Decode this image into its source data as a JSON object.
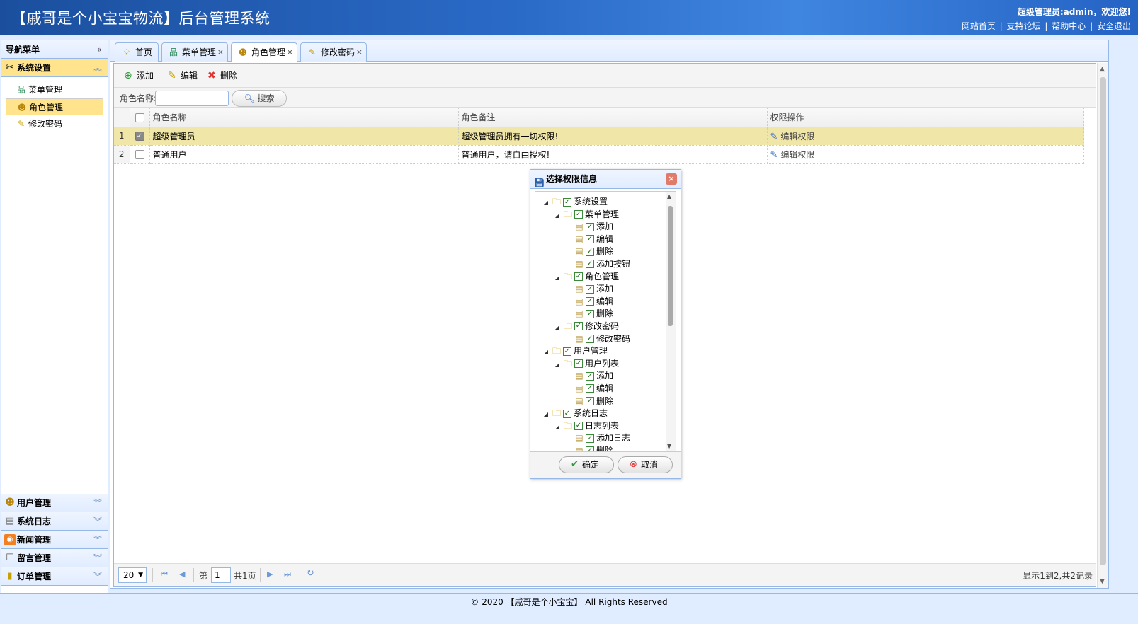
{
  "header": {
    "title": "【戚哥是个小宝宝物流】后台管理系统",
    "welcome": "超级管理员:admin，欢迎您!",
    "links": [
      "网站首页",
      "支持论坛",
      "帮助中心",
      "安全退出"
    ],
    "link_separator": "|"
  },
  "nav": {
    "title": "导航菜单",
    "collapse_icon": "«",
    "sections": [
      {
        "label": "系统设置",
        "icon": "tools-icon",
        "expanded": true
      },
      {
        "label": "用户管理",
        "icon": "users-icon"
      },
      {
        "label": "系统日志",
        "icon": "log-icon"
      },
      {
        "label": "新闻管理",
        "icon": "rss-icon"
      },
      {
        "label": "留言管理",
        "icon": "comment-icon"
      },
      {
        "label": "订单管理",
        "icon": "order-icon"
      }
    ],
    "items": [
      {
        "label": "菜单管理",
        "icon": "sitemap-icon"
      },
      {
        "label": "角色管理",
        "icon": "role-icon",
        "selected": true
      },
      {
        "label": "修改密码",
        "icon": "key-icon"
      }
    ]
  },
  "tabs": [
    {
      "label": "首页",
      "icon": "lightbulb-icon"
    },
    {
      "label": "菜单管理",
      "icon": "sitemap-icon",
      "closable": true
    },
    {
      "label": "角色管理",
      "icon": "role-icon",
      "closable": true,
      "active": true
    },
    {
      "label": "修改密码",
      "icon": "key-icon",
      "closable": true
    }
  ],
  "toolbar": {
    "add": "添加",
    "edit": "编辑",
    "delete": "删除"
  },
  "search": {
    "label": "角色名称:",
    "button": "搜索",
    "value": ""
  },
  "grid": {
    "columns": [
      "角色名称",
      "角色备注",
      "权限操作"
    ],
    "rows": [
      {
        "num": "1",
        "name": "超级管理员",
        "remark": "超级管理员拥有一切权限!",
        "action": "编辑权限",
        "checked": true
      },
      {
        "num": "2",
        "name": "普通用户",
        "remark": "普通用户，请自由授权!",
        "action": "编辑权限",
        "checked": false
      }
    ]
  },
  "pager": {
    "page_size": "20",
    "page_prefix": "第",
    "page_value": "1",
    "page_total": "共1页",
    "info": "显示1到2,共2记录"
  },
  "dialog": {
    "title": "选择权限信息",
    "ok": "确定",
    "cancel": "取消",
    "tree": [
      {
        "label": "系统设置",
        "level": 0,
        "type": "folder"
      },
      {
        "label": "菜单管理",
        "level": 1,
        "type": "folder"
      },
      {
        "label": "添加",
        "level": 2,
        "type": "file"
      },
      {
        "label": "编辑",
        "level": 2,
        "type": "file"
      },
      {
        "label": "删除",
        "level": 2,
        "type": "file"
      },
      {
        "label": "添加按钮",
        "level": 2,
        "type": "file"
      },
      {
        "label": "角色管理",
        "level": 1,
        "type": "folder"
      },
      {
        "label": "添加",
        "level": 2,
        "type": "file"
      },
      {
        "label": "编辑",
        "level": 2,
        "type": "file"
      },
      {
        "label": "删除",
        "level": 2,
        "type": "file"
      },
      {
        "label": "修改密码",
        "level": 1,
        "type": "folder"
      },
      {
        "label": "修改密码",
        "level": 2,
        "type": "file"
      },
      {
        "label": "用户管理",
        "level": 0,
        "type": "folder"
      },
      {
        "label": "用户列表",
        "level": 1,
        "type": "folder"
      },
      {
        "label": "添加",
        "level": 2,
        "type": "file"
      },
      {
        "label": "编辑",
        "level": 2,
        "type": "file"
      },
      {
        "label": "删除",
        "level": 2,
        "type": "file"
      },
      {
        "label": "系统日志",
        "level": 0,
        "type": "folder"
      },
      {
        "label": "日志列表",
        "level": 1,
        "type": "folder"
      },
      {
        "label": "添加日志",
        "level": 2,
        "type": "file"
      },
      {
        "label": "删除",
        "level": 2,
        "type": "file"
      }
    ]
  },
  "footer": "© 2020 【戚哥是个小宝宝】 All Rights Reserved",
  "colors": {
    "header_bg": "#1b4f9e",
    "panel_border": "#95b8e7",
    "selected_bg": "#ffe48d",
    "row_selected_bg": "#f0e6a8"
  }
}
